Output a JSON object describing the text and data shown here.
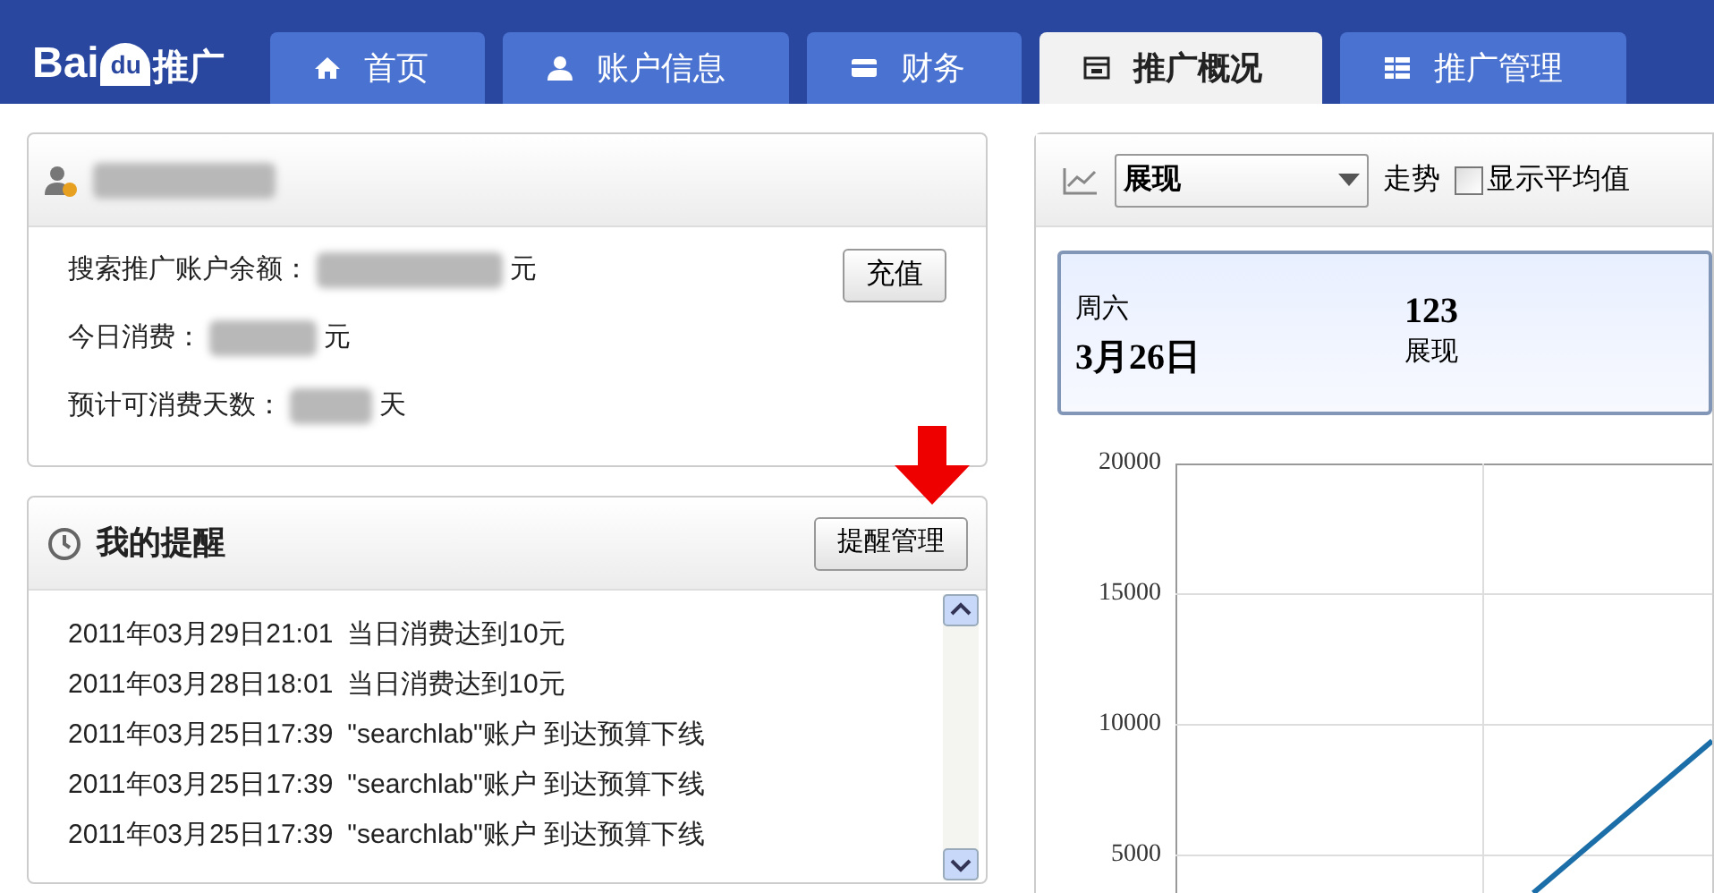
{
  "header": {
    "logo_text": "Bai",
    "logo_du": "du",
    "logo_suffix": "推广",
    "tabs": [
      {
        "label": "首页",
        "kind": "home",
        "selected": false
      },
      {
        "label": "账户信息",
        "kind": "user",
        "selected": false
      },
      {
        "label": "财务",
        "kind": "card",
        "selected": false
      },
      {
        "label": "推广概况",
        "kind": "layout",
        "selected": true
      },
      {
        "label": "推广管理",
        "kind": "grid",
        "selected": false
      }
    ]
  },
  "account": {
    "rows": [
      {
        "label": "搜索推广账户余额：",
        "unit": "元"
      },
      {
        "label": "今日消费：",
        "unit": "元"
      },
      {
        "label": "预计可消费天数：",
        "unit": "天"
      }
    ],
    "button": "充值"
  },
  "reminders": {
    "title": "我的提醒",
    "button": "提醒管理",
    "items": [
      {
        "time": "2011年03月29日21:01",
        "message": "当日消费达到10元"
      },
      {
        "time": "2011年03月28日18:01",
        "message": "当日消费达到10元"
      },
      {
        "time": "2011年03月25日17:39",
        "message": "\"searchlab\"账户 到达预算下线"
      },
      {
        "time": "2011年03月25日17:39",
        "message": "\"searchlab\"账户 到达预算下线"
      },
      {
        "time": "2011年03月25日17:39",
        "message": "\"searchlab\"账户 到达预算下线"
      }
    ]
  },
  "trend": {
    "metric": "展现",
    "trend_label": "走势",
    "show_average": {
      "label": "显示平均值",
      "checked": false
    },
    "summary": {
      "weekday": "周六",
      "date": "3月26日",
      "value": "123",
      "value_label": "展现"
    },
    "y_tick_labels": [
      "20000",
      "15000",
      "10000",
      "5000"
    ]
  }
}
